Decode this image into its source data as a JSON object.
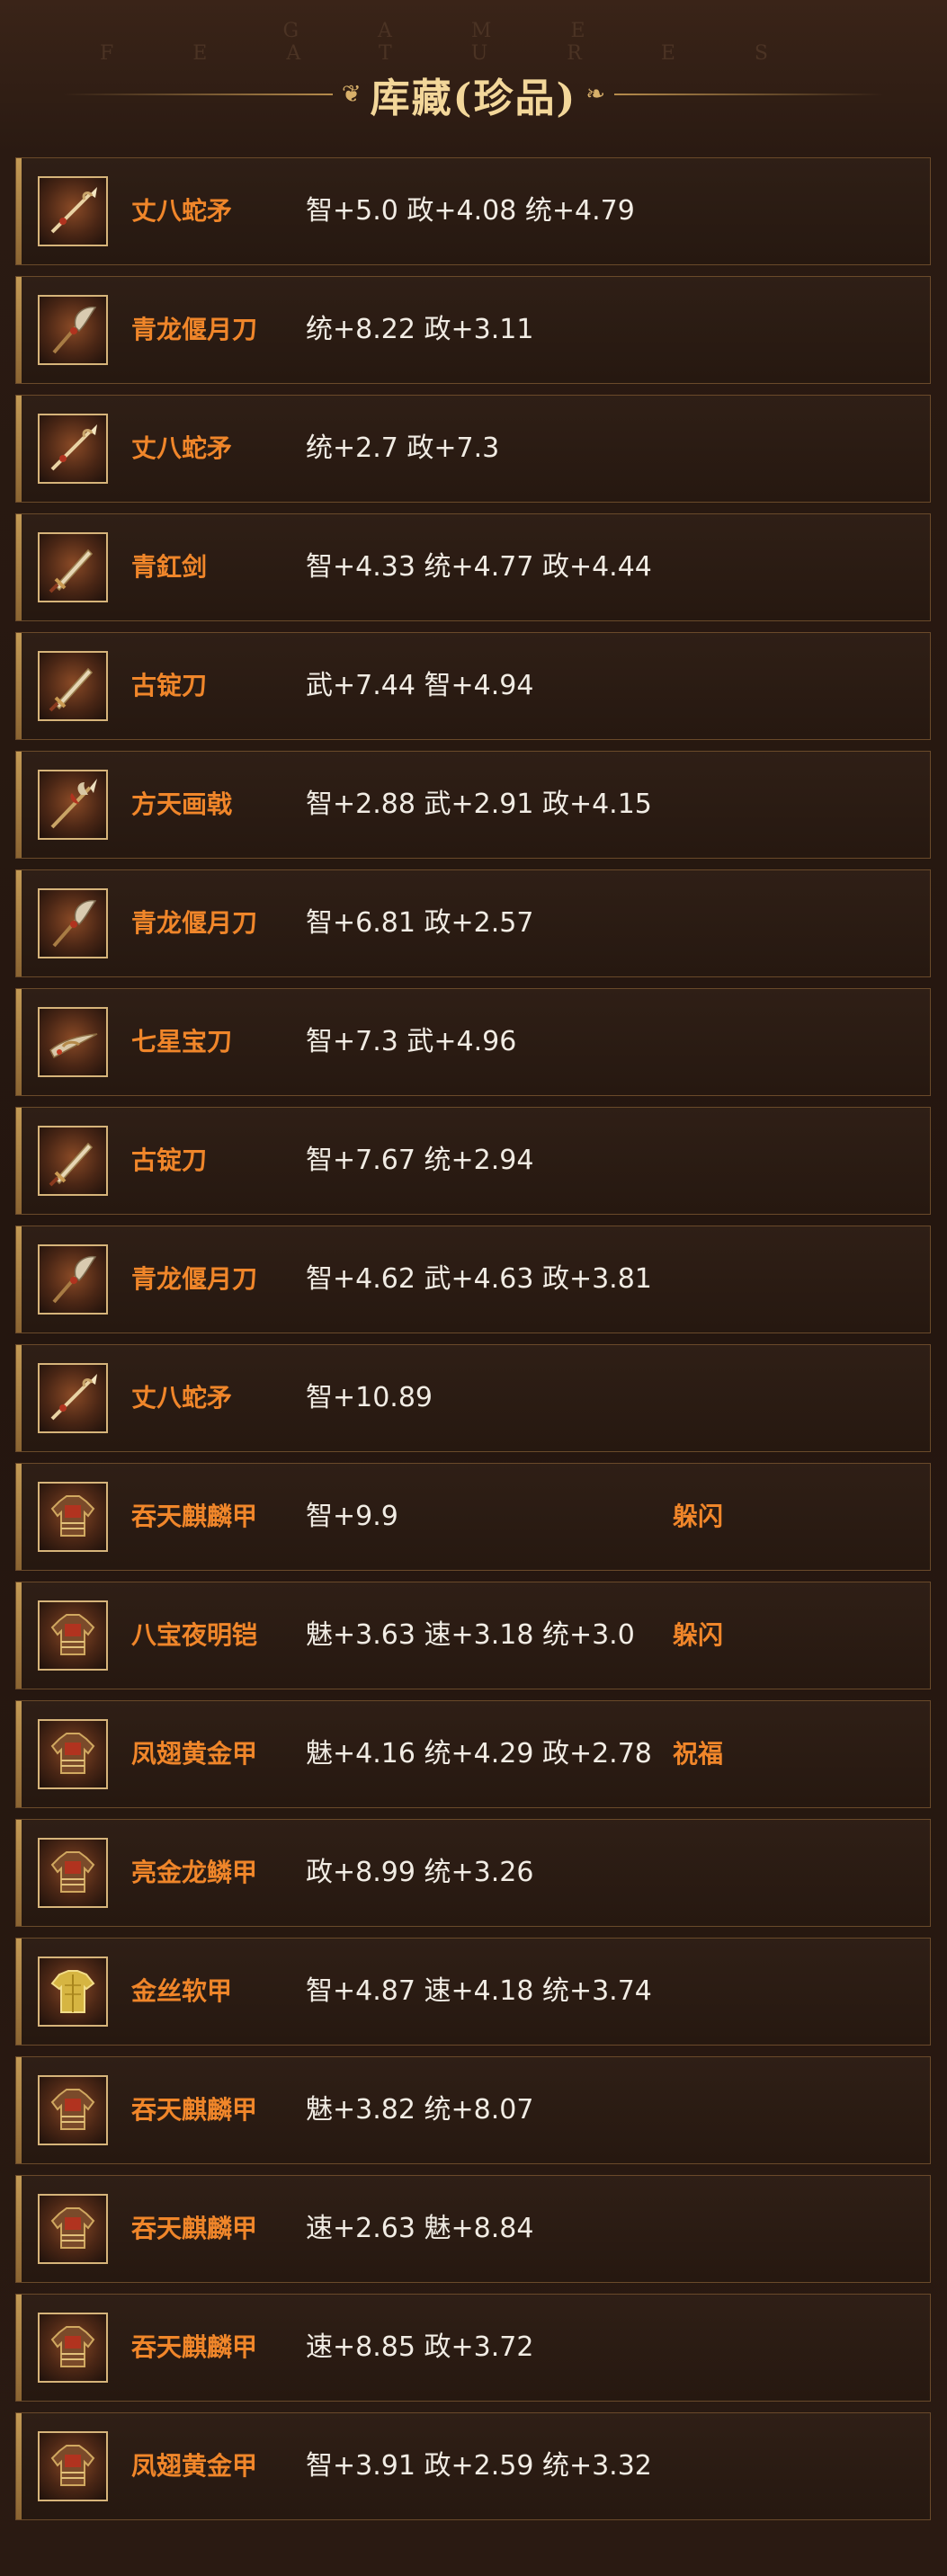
{
  "header": {
    "subtitle_en": "GAME FEATURES",
    "title": "库藏(珍品)"
  },
  "items": [
    {
      "name": "丈八蛇矛",
      "stats": "智+5.0 政+4.08 统+4.79",
      "skill": "",
      "icon": "spear-icon"
    },
    {
      "name": "青龙偃月刀",
      "stats": "统+8.22 政+3.11",
      "skill": "",
      "icon": "glaive-icon"
    },
    {
      "name": "丈八蛇矛",
      "stats": "统+2.7 政+7.3",
      "skill": "",
      "icon": "spear-icon"
    },
    {
      "name": "青釭剑",
      "stats": "智+4.33 统+4.77 政+4.44",
      "skill": "",
      "icon": "sword-icon"
    },
    {
      "name": "古锭刀",
      "stats": "武+7.44 智+4.94",
      "skill": "",
      "icon": "sword-icon"
    },
    {
      "name": "方天画戟",
      "stats": "智+2.88 武+2.91 政+4.15",
      "skill": "",
      "icon": "halberd-icon"
    },
    {
      "name": "青龙偃月刀",
      "stats": "智+6.81 政+2.57",
      "skill": "",
      "icon": "glaive-icon"
    },
    {
      "name": "七星宝刀",
      "stats": "智+7.3 武+4.96",
      "skill": "",
      "icon": "dragon-blade-icon"
    },
    {
      "name": "古锭刀",
      "stats": "智+7.67 统+2.94",
      "skill": "",
      "icon": "sword-icon"
    },
    {
      "name": "青龙偃月刀",
      "stats": "智+4.62 武+4.63 政+3.81",
      "skill": "",
      "icon": "glaive-icon"
    },
    {
      "name": "丈八蛇矛",
      "stats": "智+10.89",
      "skill": "",
      "icon": "spear-icon"
    },
    {
      "name": "吞天麒麟甲",
      "stats": "智+9.9",
      "skill": "躲闪",
      "icon": "armor-icon"
    },
    {
      "name": "八宝夜明铠",
      "stats": "魅+3.63 速+3.18 统+3.0",
      "skill": "躲闪",
      "icon": "armor-icon"
    },
    {
      "name": "凤翅黄金甲",
      "stats": "魅+4.16 统+4.29 政+2.78",
      "skill": "祝福",
      "icon": "armor-icon"
    },
    {
      "name": "亮金龙鳞甲",
      "stats": "政+8.99 统+3.26",
      "skill": "",
      "icon": "armor-icon"
    },
    {
      "name": "金丝软甲",
      "stats": "智+4.87 速+4.18 统+3.74",
      "skill": "",
      "icon": "silk-armor-icon"
    },
    {
      "name": "吞天麒麟甲",
      "stats": "魅+3.82 统+8.07",
      "skill": "",
      "icon": "armor-icon"
    },
    {
      "name": "吞天麒麟甲",
      "stats": "速+2.63 魅+8.84",
      "skill": "",
      "icon": "armor-icon"
    },
    {
      "name": "吞天麒麟甲",
      "stats": "速+8.85 政+3.72",
      "skill": "",
      "icon": "armor-icon"
    },
    {
      "name": "凤翅黄金甲",
      "stats": "智+3.91 政+2.59 统+3.32",
      "skill": "",
      "icon": "armor-icon"
    }
  ],
  "colors": {
    "name": "#f0862a",
    "stats": "#f1ece4",
    "title": "#f3d79a",
    "border": "#d6b47a"
  }
}
